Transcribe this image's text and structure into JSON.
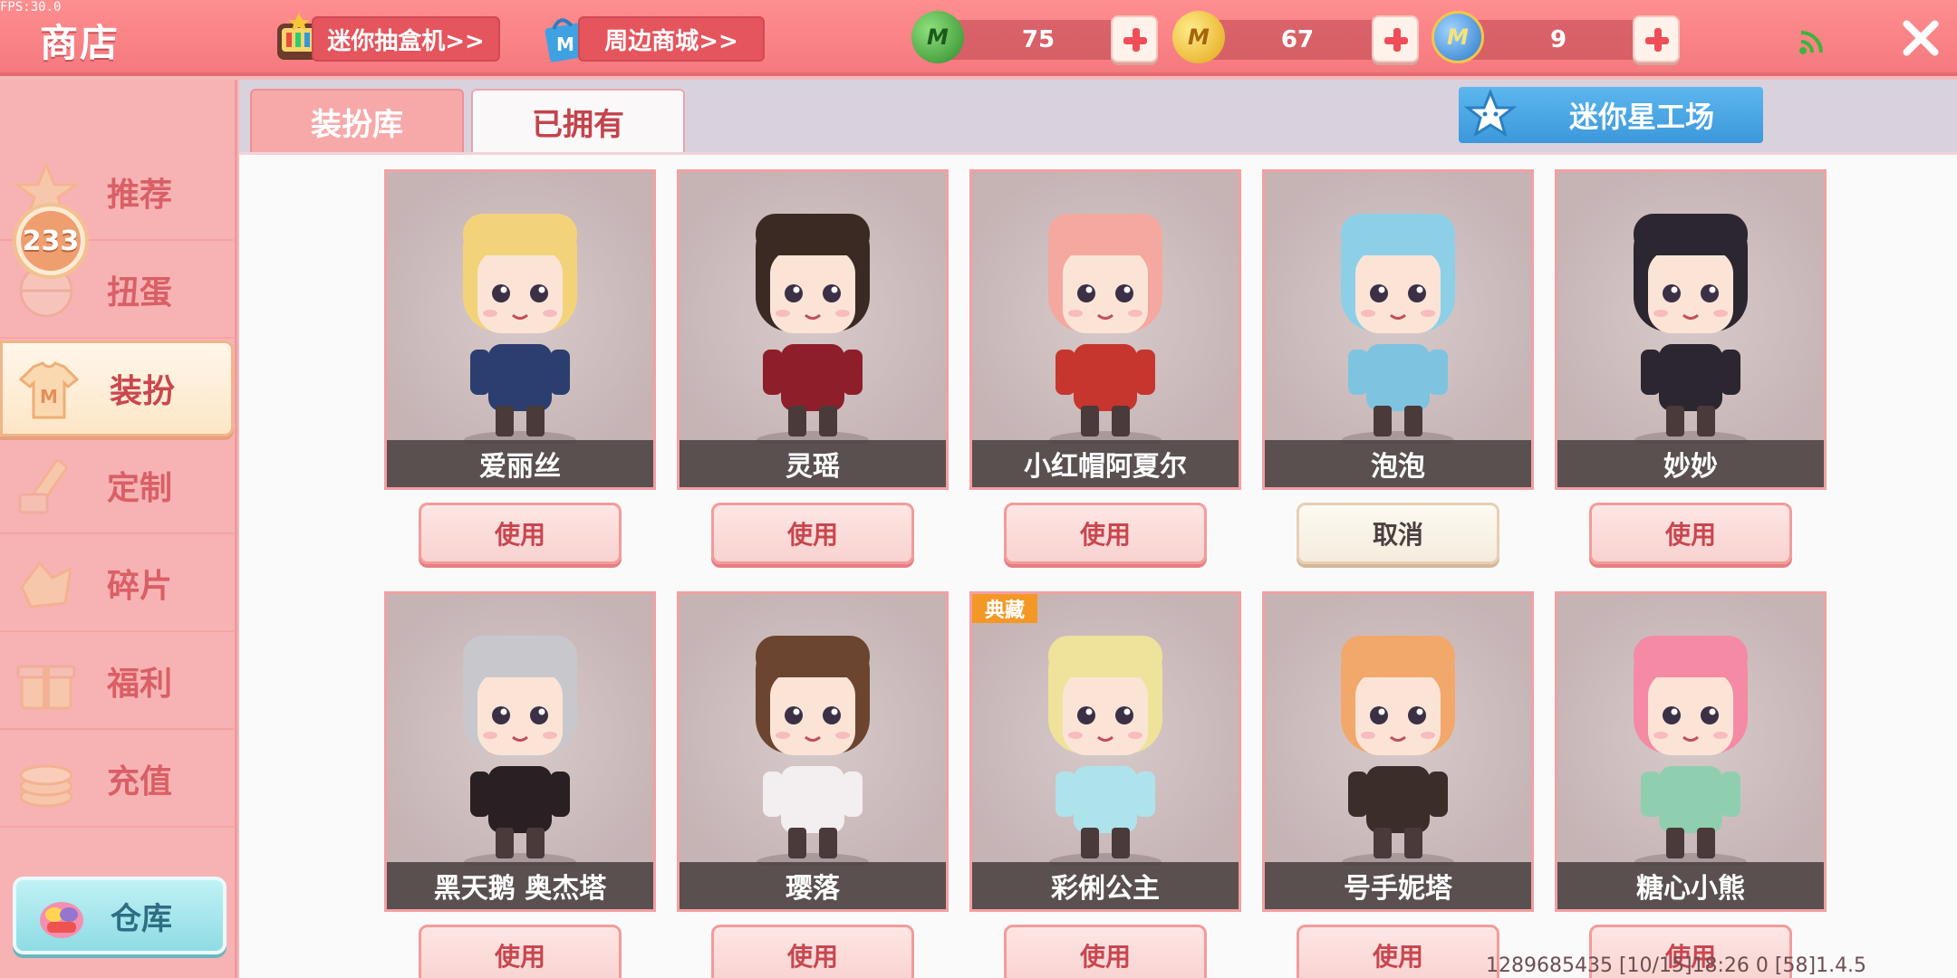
{
  "fps": "FPS:30.0",
  "header": {
    "title": "商店",
    "gacha_button": "迷你抽盒机>>",
    "mall_button": "周边商城>>",
    "currencies": [
      {
        "icon": "green-gem-icon",
        "value": "75",
        "color": "#3f9d3a"
      },
      {
        "icon": "gold-coin-icon",
        "value": "67",
        "color": "#f2c12e"
      },
      {
        "icon": "blue-mini-coin-icon",
        "value": "9",
        "color": "#3e8fd8"
      }
    ]
  },
  "sidebar": {
    "badge": "233",
    "items": [
      {
        "label": "推荐",
        "icon": "star-icon"
      },
      {
        "label": "扭蛋",
        "icon": "gacha-egg-icon"
      },
      {
        "label": "装扮",
        "icon": "shirt-icon"
      },
      {
        "label": "定制",
        "icon": "pencil-icon"
      },
      {
        "label": "碎片",
        "icon": "shard-icon"
      },
      {
        "label": "福利",
        "icon": "gift-icon"
      },
      {
        "label": "充值",
        "icon": "coin-stack-icon"
      }
    ],
    "active_index": 2,
    "warehouse": "仓库"
  },
  "tabs": [
    {
      "label": "装扮库",
      "active": false
    },
    {
      "label": "已拥有",
      "active": true
    }
  ],
  "workshop_button": "迷你星工场",
  "skins_row1": [
    {
      "name": "爱丽丝",
      "button": "使用",
      "hair": "#f3d37a",
      "outfit": "#2c3e70"
    },
    {
      "name": "灵瑶",
      "button": "使用",
      "hair": "#3b2a24",
      "outfit": "#8e1f2a"
    },
    {
      "name": "小红帽阿夏尔",
      "button": "使用",
      "hair": "#f4a8a0",
      "outfit": "#c7352f"
    },
    {
      "name": "泡泡",
      "button": "取消",
      "hair": "#8ecfe8",
      "outfit": "#7ec4e0"
    },
    {
      "name": "妙妙",
      "button": "使用",
      "hair": "#2b2630",
      "outfit": "#2b2630"
    }
  ],
  "skins_row2": [
    {
      "name": "黑天鹅 奥杰塔",
      "button": "使用",
      "hair": "#c8c8cc",
      "outfit": "#2a1f22"
    },
    {
      "name": "璎落",
      "button": "使用",
      "hair": "#6b4530",
      "outfit": "#f3eef0"
    },
    {
      "name": "彩俐公主",
      "button": "使用",
      "hair": "#efe29a",
      "outfit": "#aee3ec",
      "tag": "典藏"
    },
    {
      "name": "号手妮塔",
      "button": "使用",
      "hair": "#f1a86a",
      "outfit": "#3a2d2a"
    },
    {
      "name": "糖心小熊",
      "button": "使用",
      "hair": "#f58aa4",
      "outfit": "#8fcfb0"
    }
  ],
  "footer": "1289685435  [10/15]18:26 0   [58]1.4.5"
}
